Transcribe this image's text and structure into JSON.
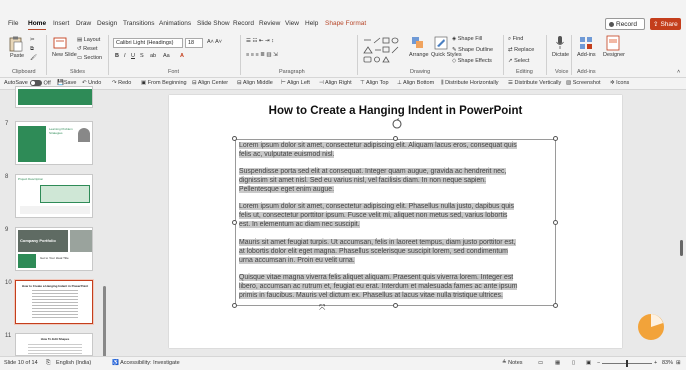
{
  "ribbon_tabs": [
    "File",
    "Home",
    "Insert",
    "Draw",
    "Design",
    "Transitions",
    "Animations",
    "Slide Show",
    "Record",
    "Review",
    "View",
    "Help",
    "Shape Format"
  ],
  "active_tab": "Home",
  "record_label": "Record",
  "share_label": "Share",
  "ribbon": {
    "paste": "Paste",
    "layout": "Layout",
    "reset": "Reset",
    "section": "Section",
    "new_slide": "New Slide",
    "font_name": "Calibri Light (Headings)",
    "font_size": "18",
    "arrange": "Arrange",
    "quick_styles": "Quick Styles",
    "shape_fill": "Shape Fill",
    "shape_outline": "Shape Outline",
    "shape_effects": "Shape Effects",
    "find": "Find",
    "replace": "Replace",
    "select": "Select",
    "dictate": "Dictate",
    "add_ins": "Add-ins",
    "designer": "Designer",
    "groups": {
      "clipboard": "Clipboard",
      "slides": "Slides",
      "font": "Font",
      "paragraph": "Paragraph",
      "drawing": "Drawing",
      "editing": "Editing",
      "voice": "Voice",
      "addins": "Add-ins"
    }
  },
  "qat": {
    "autosave": "AutoSave",
    "autosave_state": "Off",
    "save": "Save",
    "undo": "Undo",
    "redo": "Redo",
    "from_beginning": "From Beginning",
    "align_center": "Align Center",
    "align_middle": "Align Middle",
    "align_left": "Align Left",
    "align_right": "Align Right",
    "align_top": "Align Top",
    "align_bottom": "Align Bottom",
    "distribute_h": "Distribute Horizontally",
    "distribute_v": "Distribute Vertically",
    "screenshot": "Screenshot",
    "icons": "Icons"
  },
  "thumbnails": [
    {
      "number": "7",
      "title": "Learning Problem Strategies"
    },
    {
      "number": "8",
      "title": "Project Description"
    },
    {
      "number": "9",
      "title": "Company Portfolio"
    },
    {
      "number": "10",
      "title": "How to Create a Hanging Indent in PowerPoint"
    },
    {
      "number": "11",
      "title": "How To Edit Shapes"
    }
  ],
  "thumb9_caption": "Get to Your Ideal Title",
  "slide": {
    "title": "How to Create a Hanging Indent in PowerPoint",
    "paragraphs": [
      [
        "Lorem ipsum dolor sit amet, consectetur adipiscing elit. Aliquam lacus eros, consequat quis",
        "felis ac, vulputate euismod nisl."
      ],
      [
        "Suspendisse porta sed elit at consequat. Integer quam augue, gravida ac hendrerit nec,",
        "dignissim sit amet nisl. Sed eu varius nisl, vel facilisis diam. In non neque sapien.",
        "Pellentesque eget enim augue."
      ],
      [
        "Lorem ipsum dolor sit amet, consectetur adipiscing elit. Phasellus nulla justo, dapibus quis",
        "felis ut, consectetur porttitor ipsum. Fusce velit mi, aliquet non metus sed, varius lobortis",
        "est. In elementum ac diam nec suscipit."
      ],
      [
        "Mauris sit amet feugiat turpis. Ut accumsan, felis in laoreet tempus, diam justo porttitor est,",
        "at lobortis dolor elit eget magna. Phasellus scelerisque suscipit lorem, sed condimentum",
        "urna accumsan in. Proin eu velit urna."
      ],
      [
        "Quisque vitae magna viverra felis aliquet aliquam. Praesent quis viverra lorem. Integer est",
        "libero, accumsan ac rutrum et, feugiat eu erat. Interdum et malesuada fames ac ante ipsum",
        "primis in faucibus. Mauris vel dictum ex. Phasellus at lacus vitae nulla tristique ultrices."
      ]
    ]
  },
  "status": {
    "slide_count": "Slide 10 of 14",
    "language": "English (India)",
    "accessibility": "Accessibility: Investigate",
    "notes": "Notes",
    "zoom": "83%"
  },
  "colors": {
    "accent": "#c43e1c",
    "selection": "#c9c9c9",
    "thumb_green": "#2e8b57"
  }
}
